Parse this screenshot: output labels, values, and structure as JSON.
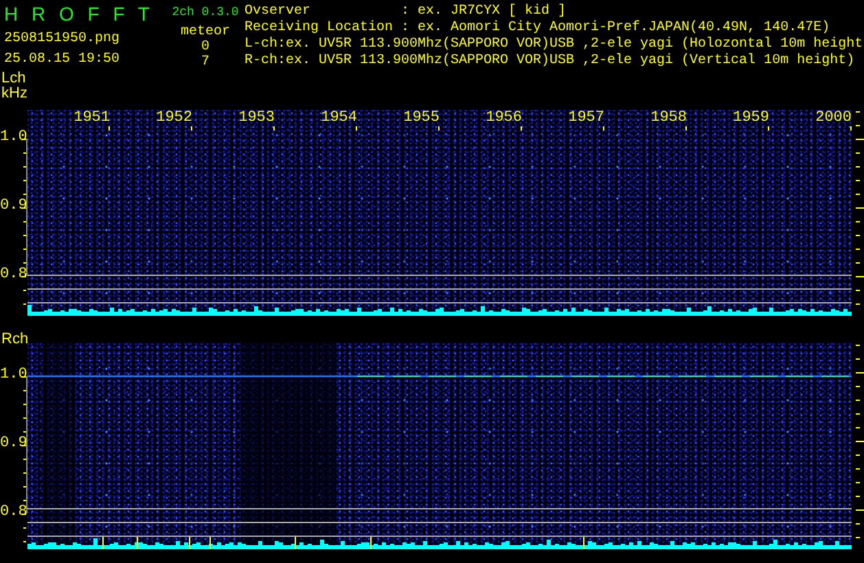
{
  "app_title": "H R O F F T",
  "version": "2ch 0.3.0",
  "filename": "2508151950.png",
  "datetime": "25.08.15 19:50",
  "meteor_label": "meteor",
  "meteor_counts": [
    "0",
    "7"
  ],
  "info_lines": [
    "Ovserver           : ex. JR7CYX [ kid ]",
    "Receiving Location : ex. Aomori City Aomori-Pref.JAPAN(40.49N, 140.47E)",
    "L-ch:ex. UV5R 113.900Mhz(SAPPORO VOR)USB ,2-ele yagi (Holozontal 10m height",
    "R-ch:ex. UV5R 113.900Mhz(SAPPORO VOR)USB ,2-ele yagi (Vertical 10m height)"
  ],
  "channels": [
    {
      "label": "Lch",
      "unit": "kHz",
      "time_labels": [
        "1951",
        "1952",
        "1953",
        "1954",
        "1955",
        "1956",
        "1957",
        "1958",
        "1959",
        "2000"
      ],
      "freq_labels": [
        "1.0",
        "0.9",
        "0.8"
      ]
    },
    {
      "label": "Rch",
      "freq_labels": [
        "1.0",
        "0.9",
        "0.8"
      ]
    }
  ]
}
